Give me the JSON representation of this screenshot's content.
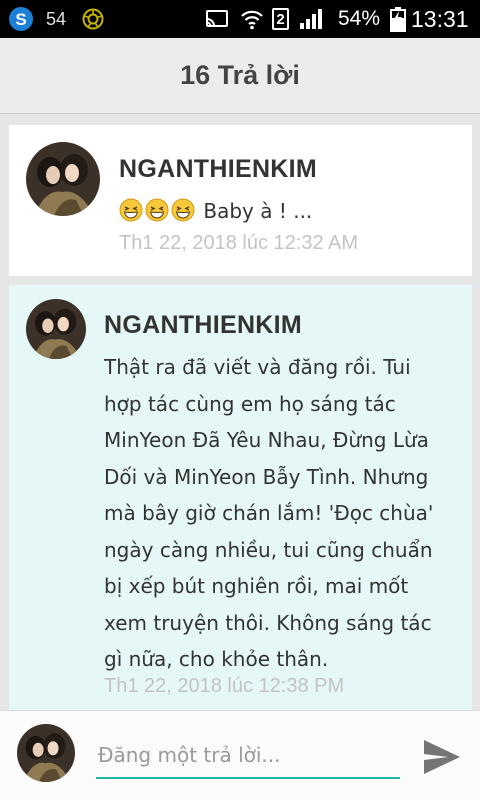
{
  "status_bar": {
    "notification_count": "54",
    "sim_slot": "2",
    "battery_percent": "54%",
    "time": "13:31",
    "icons": [
      "skype-icon",
      "camera-shutter-icon",
      "cast-icon",
      "wifi-icon",
      "sim-badge",
      "signal-icon",
      "battery-charging-icon"
    ]
  },
  "header": {
    "title": "16 Trả lời"
  },
  "comments": [
    {
      "username": "NGANTHIENKIM",
      "text": "Baby à ! ...",
      "emojis": [
        "grinning-squint-emoji",
        "grinning-squint-emoji",
        "grinning-squint-emoji"
      ],
      "timestamp": "Th1 22, 2018 lúc 12:32 AM"
    },
    {
      "username": "NGANTHIENKIM",
      "text_lines": [
        "Thật ra đã viết và đăng rồi. Tui",
        "hợp tác cùng em họ sáng tác",
        "MinYeon Đã Yêu Nhau, Đừng Lừa",
        "Dối và MinYeon Bẫy Tình. Nhưng",
        "mà bây giờ chán lắm! 'Đọc chùa'",
        "ngày càng nhiều, tui cũng chuẩn",
        "bị xếp bút nghiên rồi, mai mốt",
        "xem truyện thôi. Không sáng tác",
        "gì nữa, cho khỏe thân."
      ],
      "timestamp": "Th1 22, 2018 lúc 12:38 PM"
    }
  ],
  "compose": {
    "placeholder": "Đăng một trả lời..."
  },
  "colors": {
    "accent": "#1fb5a8",
    "highlight_card": "#e6f7f7",
    "timestamp": "#c3c3c3"
  }
}
